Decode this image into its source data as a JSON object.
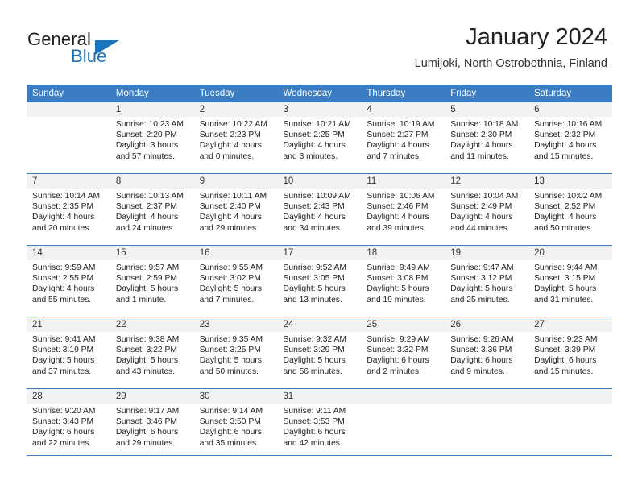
{
  "brand": {
    "word_one": "General",
    "word_two": "Blue",
    "triangle_color": "#1b75bc"
  },
  "header": {
    "title": "January 2024",
    "subtitle": "Lumijoki, North Ostrobothnia, Finland"
  },
  "theme": {
    "header_blue": "#3b7dc4",
    "daynum_band": "#f2f2f2",
    "text": "#222222"
  },
  "calendar": {
    "weekday_headers": [
      "Sunday",
      "Monday",
      "Tuesday",
      "Wednesday",
      "Thursday",
      "Friday",
      "Saturday"
    ],
    "weeks": [
      [
        {
          "day": "",
          "sunrise": "",
          "sunset": "",
          "daylight_line1": "",
          "daylight_line2": ""
        },
        {
          "day": "1",
          "sunrise": "Sunrise: 10:23 AM",
          "sunset": "Sunset: 2:20 PM",
          "daylight_line1": "Daylight: 3 hours",
          "daylight_line2": "and 57 minutes."
        },
        {
          "day": "2",
          "sunrise": "Sunrise: 10:22 AM",
          "sunset": "Sunset: 2:23 PM",
          "daylight_line1": "Daylight: 4 hours",
          "daylight_line2": "and 0 minutes."
        },
        {
          "day": "3",
          "sunrise": "Sunrise: 10:21 AM",
          "sunset": "Sunset: 2:25 PM",
          "daylight_line1": "Daylight: 4 hours",
          "daylight_line2": "and 3 minutes."
        },
        {
          "day": "4",
          "sunrise": "Sunrise: 10:19 AM",
          "sunset": "Sunset: 2:27 PM",
          "daylight_line1": "Daylight: 4 hours",
          "daylight_line2": "and 7 minutes."
        },
        {
          "day": "5",
          "sunrise": "Sunrise: 10:18 AM",
          "sunset": "Sunset: 2:30 PM",
          "daylight_line1": "Daylight: 4 hours",
          "daylight_line2": "and 11 minutes."
        },
        {
          "day": "6",
          "sunrise": "Sunrise: 10:16 AM",
          "sunset": "Sunset: 2:32 PM",
          "daylight_line1": "Daylight: 4 hours",
          "daylight_line2": "and 15 minutes."
        }
      ],
      [
        {
          "day": "7",
          "sunrise": "Sunrise: 10:14 AM",
          "sunset": "Sunset: 2:35 PM",
          "daylight_line1": "Daylight: 4 hours",
          "daylight_line2": "and 20 minutes."
        },
        {
          "day": "8",
          "sunrise": "Sunrise: 10:13 AM",
          "sunset": "Sunset: 2:37 PM",
          "daylight_line1": "Daylight: 4 hours",
          "daylight_line2": "and 24 minutes."
        },
        {
          "day": "9",
          "sunrise": "Sunrise: 10:11 AM",
          "sunset": "Sunset: 2:40 PM",
          "daylight_line1": "Daylight: 4 hours",
          "daylight_line2": "and 29 minutes."
        },
        {
          "day": "10",
          "sunrise": "Sunrise: 10:09 AM",
          "sunset": "Sunset: 2:43 PM",
          "daylight_line1": "Daylight: 4 hours",
          "daylight_line2": "and 34 minutes."
        },
        {
          "day": "11",
          "sunrise": "Sunrise: 10:06 AM",
          "sunset": "Sunset: 2:46 PM",
          "daylight_line1": "Daylight: 4 hours",
          "daylight_line2": "and 39 minutes."
        },
        {
          "day": "12",
          "sunrise": "Sunrise: 10:04 AM",
          "sunset": "Sunset: 2:49 PM",
          "daylight_line1": "Daylight: 4 hours",
          "daylight_line2": "and 44 minutes."
        },
        {
          "day": "13",
          "sunrise": "Sunrise: 10:02 AM",
          "sunset": "Sunset: 2:52 PM",
          "daylight_line1": "Daylight: 4 hours",
          "daylight_line2": "and 50 minutes."
        }
      ],
      [
        {
          "day": "14",
          "sunrise": "Sunrise: 9:59 AM",
          "sunset": "Sunset: 2:55 PM",
          "daylight_line1": "Daylight: 4 hours",
          "daylight_line2": "and 55 minutes."
        },
        {
          "day": "15",
          "sunrise": "Sunrise: 9:57 AM",
          "sunset": "Sunset: 2:59 PM",
          "daylight_line1": "Daylight: 5 hours",
          "daylight_line2": "and 1 minute."
        },
        {
          "day": "16",
          "sunrise": "Sunrise: 9:55 AM",
          "sunset": "Sunset: 3:02 PM",
          "daylight_line1": "Daylight: 5 hours",
          "daylight_line2": "and 7 minutes."
        },
        {
          "day": "17",
          "sunrise": "Sunrise: 9:52 AM",
          "sunset": "Sunset: 3:05 PM",
          "daylight_line1": "Daylight: 5 hours",
          "daylight_line2": "and 13 minutes."
        },
        {
          "day": "18",
          "sunrise": "Sunrise: 9:49 AM",
          "sunset": "Sunset: 3:08 PM",
          "daylight_line1": "Daylight: 5 hours",
          "daylight_line2": "and 19 minutes."
        },
        {
          "day": "19",
          "sunrise": "Sunrise: 9:47 AM",
          "sunset": "Sunset: 3:12 PM",
          "daylight_line1": "Daylight: 5 hours",
          "daylight_line2": "and 25 minutes."
        },
        {
          "day": "20",
          "sunrise": "Sunrise: 9:44 AM",
          "sunset": "Sunset: 3:15 PM",
          "daylight_line1": "Daylight: 5 hours",
          "daylight_line2": "and 31 minutes."
        }
      ],
      [
        {
          "day": "21",
          "sunrise": "Sunrise: 9:41 AM",
          "sunset": "Sunset: 3:19 PM",
          "daylight_line1": "Daylight: 5 hours",
          "daylight_line2": "and 37 minutes."
        },
        {
          "day": "22",
          "sunrise": "Sunrise: 9:38 AM",
          "sunset": "Sunset: 3:22 PM",
          "daylight_line1": "Daylight: 5 hours",
          "daylight_line2": "and 43 minutes."
        },
        {
          "day": "23",
          "sunrise": "Sunrise: 9:35 AM",
          "sunset": "Sunset: 3:25 PM",
          "daylight_line1": "Daylight: 5 hours",
          "daylight_line2": "and 50 minutes."
        },
        {
          "day": "24",
          "sunrise": "Sunrise: 9:32 AM",
          "sunset": "Sunset: 3:29 PM",
          "daylight_line1": "Daylight: 5 hours",
          "daylight_line2": "and 56 minutes."
        },
        {
          "day": "25",
          "sunrise": "Sunrise: 9:29 AM",
          "sunset": "Sunset: 3:32 PM",
          "daylight_line1": "Daylight: 6 hours",
          "daylight_line2": "and 2 minutes."
        },
        {
          "day": "26",
          "sunrise": "Sunrise: 9:26 AM",
          "sunset": "Sunset: 3:36 PM",
          "daylight_line1": "Daylight: 6 hours",
          "daylight_line2": "and 9 minutes."
        },
        {
          "day": "27",
          "sunrise": "Sunrise: 9:23 AM",
          "sunset": "Sunset: 3:39 PM",
          "daylight_line1": "Daylight: 6 hours",
          "daylight_line2": "and 15 minutes."
        }
      ],
      [
        {
          "day": "28",
          "sunrise": "Sunrise: 9:20 AM",
          "sunset": "Sunset: 3:43 PM",
          "daylight_line1": "Daylight: 6 hours",
          "daylight_line2": "and 22 minutes."
        },
        {
          "day": "29",
          "sunrise": "Sunrise: 9:17 AM",
          "sunset": "Sunset: 3:46 PM",
          "daylight_line1": "Daylight: 6 hours",
          "daylight_line2": "and 29 minutes."
        },
        {
          "day": "30",
          "sunrise": "Sunrise: 9:14 AM",
          "sunset": "Sunset: 3:50 PM",
          "daylight_line1": "Daylight: 6 hours",
          "daylight_line2": "and 35 minutes."
        },
        {
          "day": "31",
          "sunrise": "Sunrise: 9:11 AM",
          "sunset": "Sunset: 3:53 PM",
          "daylight_line1": "Daylight: 6 hours",
          "daylight_line2": "and 42 minutes."
        },
        {
          "day": "",
          "sunrise": "",
          "sunset": "",
          "daylight_line1": "",
          "daylight_line2": ""
        },
        {
          "day": "",
          "sunrise": "",
          "sunset": "",
          "daylight_line1": "",
          "daylight_line2": ""
        },
        {
          "day": "",
          "sunrise": "",
          "sunset": "",
          "daylight_line1": "",
          "daylight_line2": ""
        }
      ]
    ]
  }
}
